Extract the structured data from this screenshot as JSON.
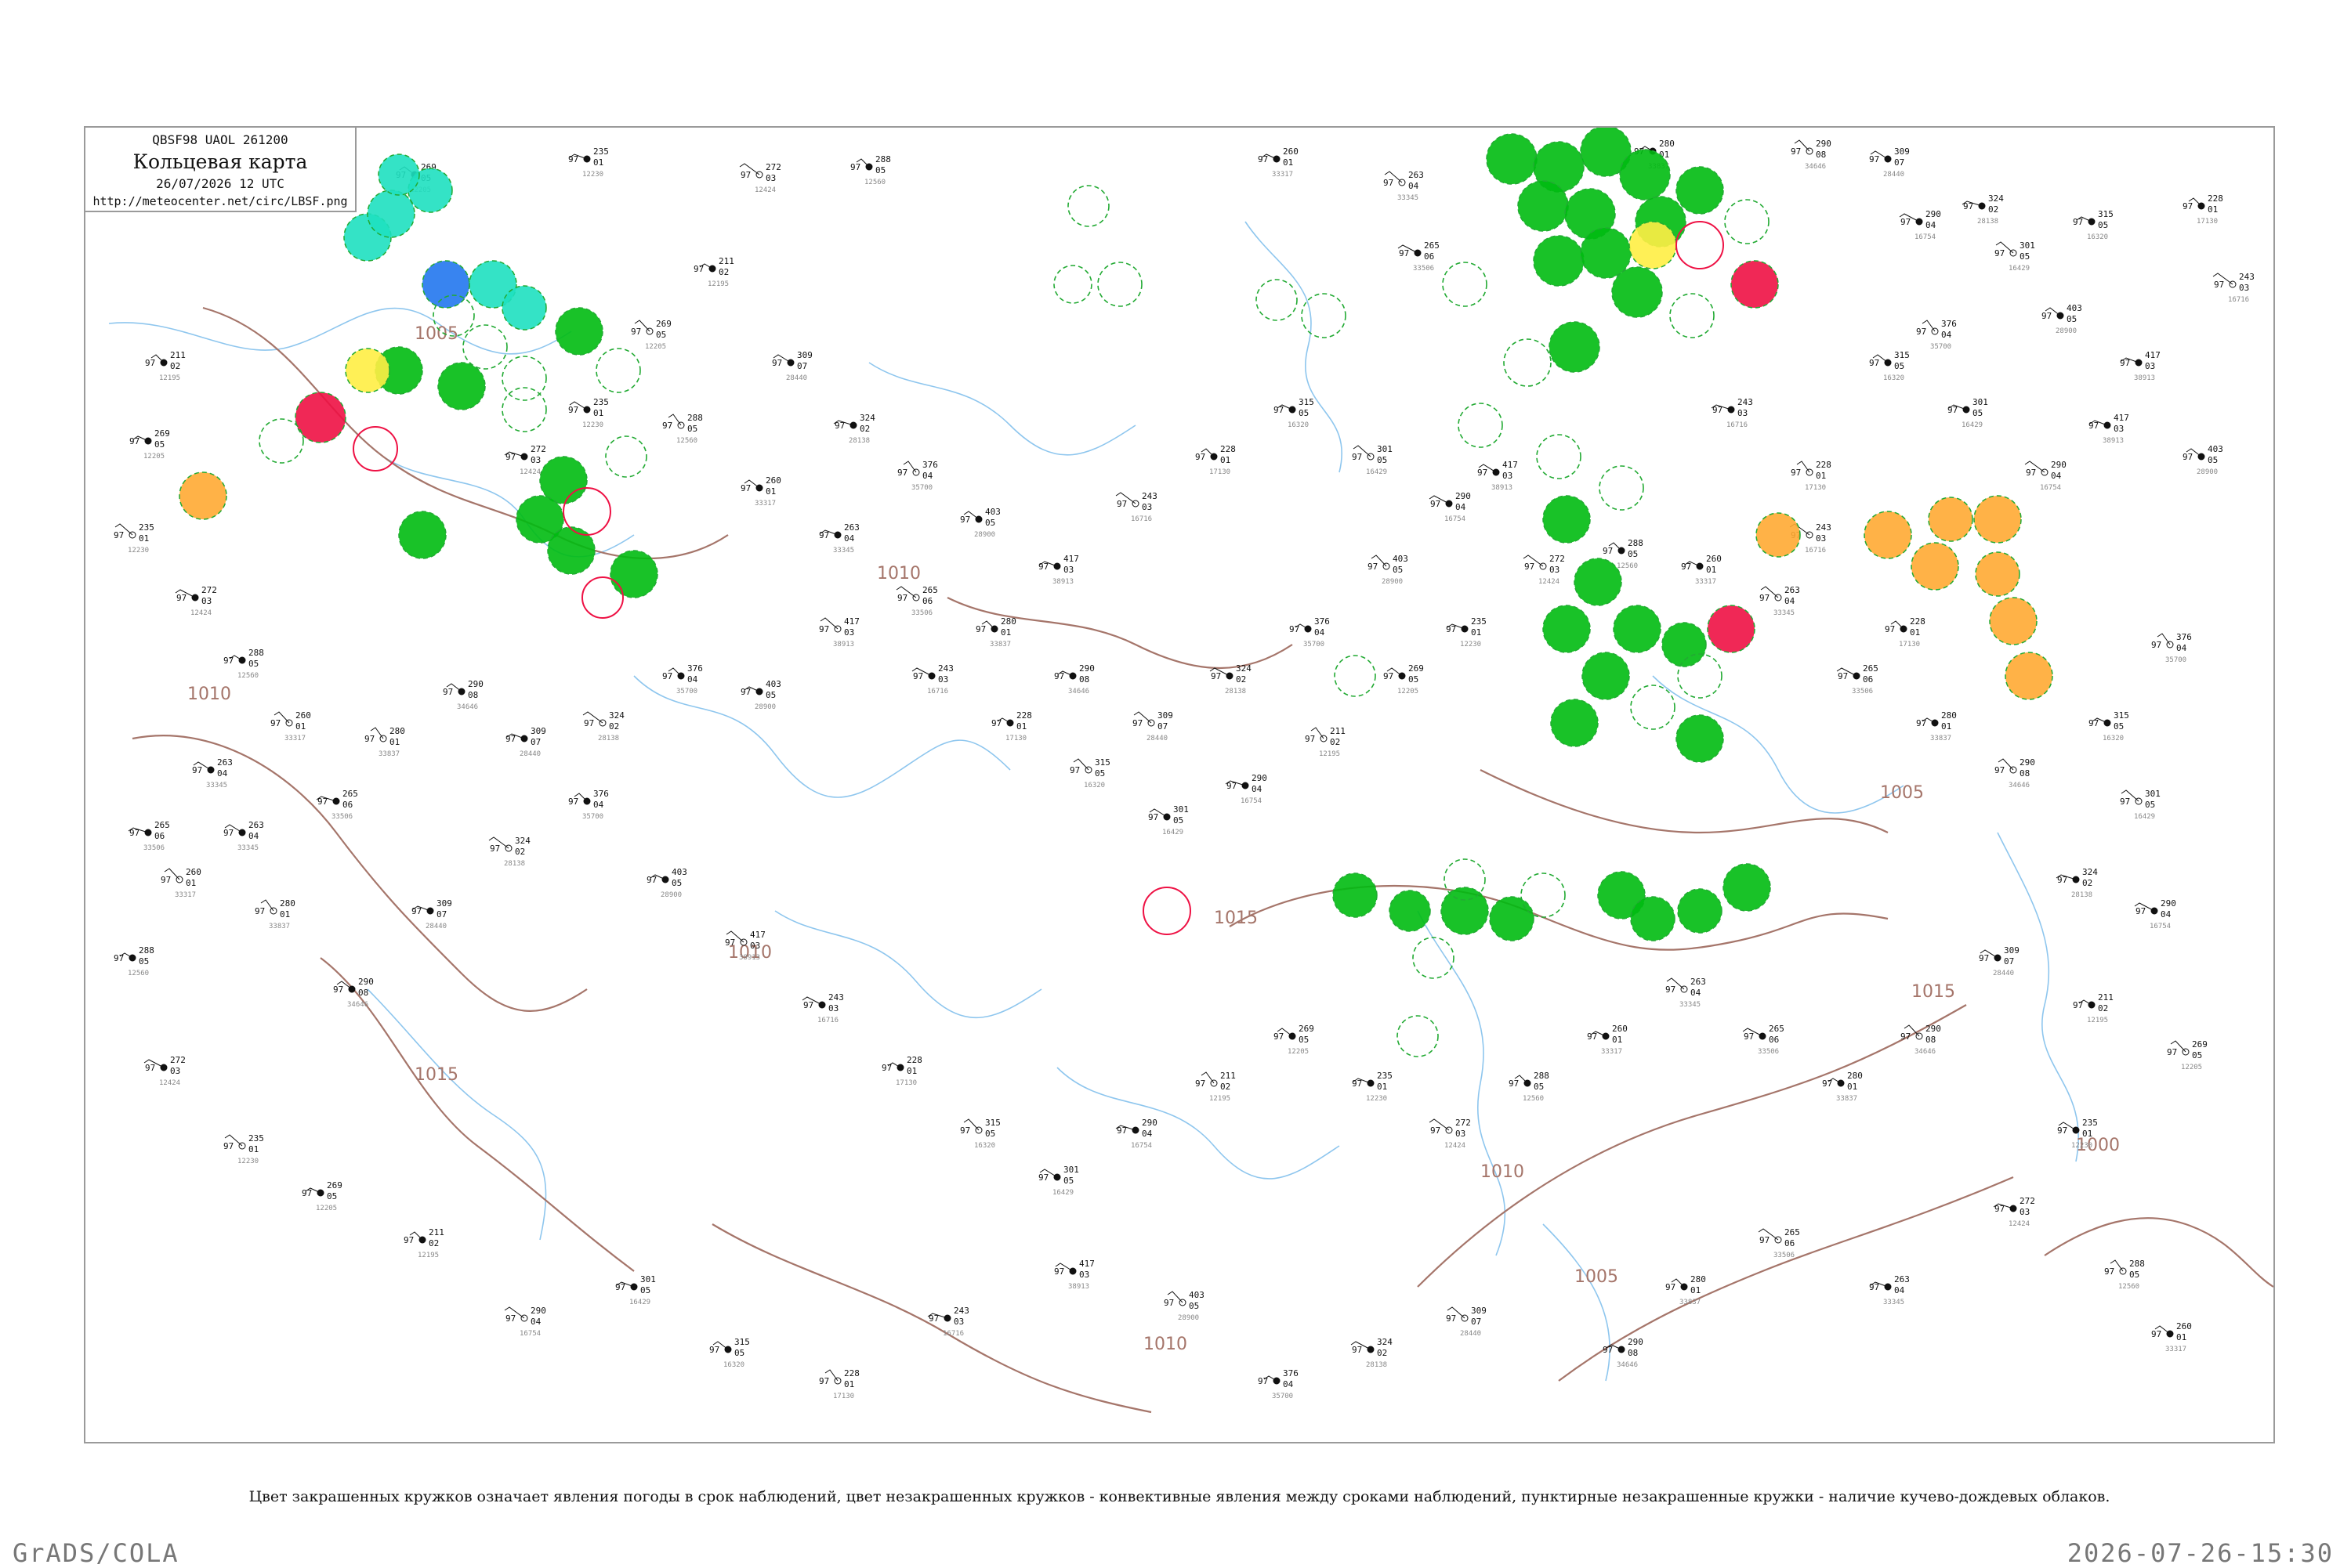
{
  "title": {
    "code_line": "QBSF98  UAOL  261200",
    "name": "Кольцевая карта",
    "datetime": "26/07/2026 12 UTC",
    "url": "http://meteocenter.net/circ/LBSF.png"
  },
  "caption": "Цвет закрашенных кружков означает явления погоды в срок наблюдений, цвет незакрашенных кружков - конвективные явления между сроками наблюдений, пунктирные незакрашенные кружки - наличие кучево-дождевых облаков.",
  "footer": {
    "left": "GrADS/COLA",
    "right": "2026-07-26-15:30"
  },
  "colors": {
    "rain": "#00bb11",
    "thunderstorm": "#ee1144",
    "shower": "#ffcc00",
    "drizzle": "#ffee44",
    "fog": "#1ee0c0",
    "snow": "#2277ee",
    "haze": "#ffaa33",
    "isobar": "#a5756a",
    "water": "#8ec6ee",
    "cb_dashed": "#22aa33"
  },
  "isobars": [
    {
      "label": "1005"
    },
    {
      "label": "1010"
    },
    {
      "label": "1015"
    },
    {
      "label": "1000"
    }
  ],
  "stations": [
    {
      "pressure": "211",
      "temp": "97",
      "wind": "02",
      "id": "12195"
    },
    {
      "pressure": "269",
      "temp": "97",
      "wind": "05",
      "id": "12205"
    },
    {
      "pressure": "235",
      "temp": "97",
      "wind": "01",
      "id": "12230"
    },
    {
      "pressure": "272",
      "temp": "97",
      "wind": "03",
      "id": "12424"
    },
    {
      "pressure": "288",
      "temp": "97",
      "wind": "05",
      "id": "12560"
    },
    {
      "pressure": "260",
      "temp": "97",
      "wind": "01",
      "id": "33317"
    },
    {
      "pressure": "263",
      "temp": "97",
      "wind": "04",
      "id": "33345"
    },
    {
      "pressure": "265",
      "temp": "97",
      "wind": "06",
      "id": "33506"
    },
    {
      "pressure": "280",
      "temp": "97",
      "wind": "01",
      "id": "33837"
    },
    {
      "pressure": "290",
      "temp": "97",
      "wind": "08",
      "id": "34646"
    },
    {
      "pressure": "309",
      "temp": "97",
      "wind": "07",
      "id": "28440"
    },
    {
      "pressure": "324",
      "temp": "97",
      "wind": "02",
      "id": "28138"
    },
    {
      "pressure": "376",
      "temp": "97",
      "wind": "04",
      "id": "35700"
    },
    {
      "pressure": "403",
      "temp": "97",
      "wind": "05",
      "id": "28900"
    },
    {
      "pressure": "417",
      "temp": "97",
      "wind": "03",
      "id": "38913"
    },
    {
      "pressure": "243",
      "temp": "97",
      "wind": "03",
      "id": "16716"
    },
    {
      "pressure": "228",
      "temp": "97",
      "wind": "01",
      "id": "17130"
    },
    {
      "pressure": "315",
      "temp": "97",
      "wind": "05",
      "id": "16320"
    },
    {
      "pressure": "301",
      "temp": "97",
      "wind": "05",
      "id": "16429"
    },
    {
      "pressure": "290",
      "temp": "97",
      "wind": "04",
      "id": "16754"
    }
  ]
}
